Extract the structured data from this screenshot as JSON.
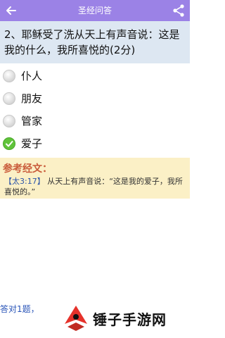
{
  "header": {
    "title": "圣经问答",
    "back_icon": "arrow-left-icon",
    "share_icon": "share-icon"
  },
  "question": {
    "text": "2、耶稣受了洗从天上有声音说：这是我的什么，我所喜悦的(2分)"
  },
  "options": [
    {
      "label": "仆人",
      "selected": false
    },
    {
      "label": "朋友",
      "selected": false
    },
    {
      "label": "管家",
      "selected": false
    },
    {
      "label": "爱子",
      "selected": true
    }
  ],
  "reference": {
    "title": "参考经文：",
    "verse": "【太3:17】",
    "text": "从天上有声音说：“这是我的爱子，我所喜悦的。”"
  },
  "footer": {
    "status": "答对1题，",
    "watermark": "锤子手游网"
  },
  "colors": {
    "header": "#9b82e6",
    "question_bg": "#dde7f2",
    "ref_bg": "#fbf0c6",
    "ref_title": "#c95b3a",
    "check": "#5fc33a"
  }
}
